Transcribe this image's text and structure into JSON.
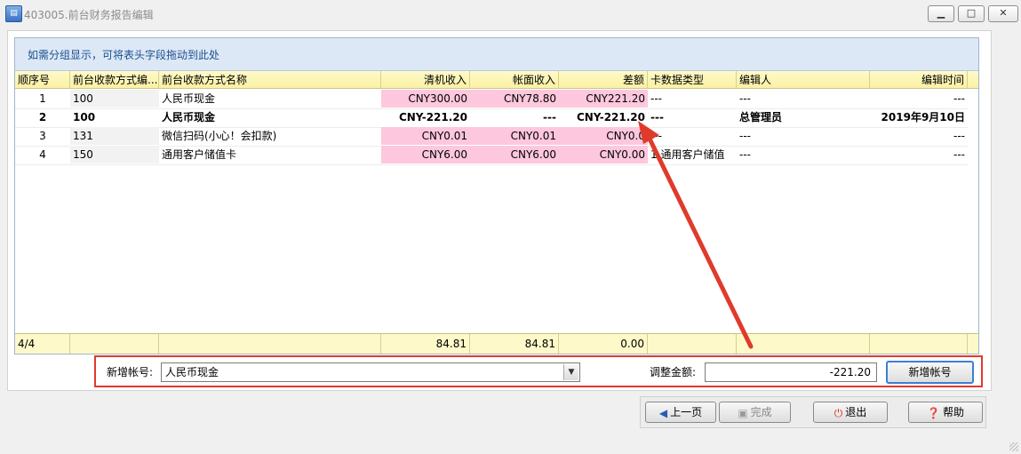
{
  "window": {
    "title": "403005.前台财务报告编辑",
    "icon_name": "app-icon",
    "minimize_icon": "minimize-icon",
    "maximize_icon": "maximize-icon",
    "close_icon": "close-icon"
  },
  "grid": {
    "group_hint": "如需分组显示，可将表头字段拖动到此处",
    "columns": [
      "顺序号",
      "前台收款方式编...",
      "前台收款方式名称",
      "清机收入",
      "帐面收入",
      "差额",
      "卡数据类型",
      "编辑人",
      "编辑时间"
    ],
    "rows": [
      {
        "seq": "1",
        "code": "100",
        "name": "人民币现金",
        "clear": "CNY300.00",
        "book": "CNY78.80",
        "diff": "CNY221.20",
        "card_type": "---",
        "editor": "---",
        "time": "---",
        "bold": false
      },
      {
        "seq": "2",
        "code": "100",
        "name": "人民币现金",
        "clear": "CNY-221.20",
        "book": "---",
        "diff": "CNY-221.20",
        "card_type": "---",
        "editor": "总管理员",
        "time": "2019年9月10日",
        "bold": true
      },
      {
        "seq": "3",
        "code": "131",
        "name": "微信扫码(小心！会扣款)",
        "clear": "CNY0.01",
        "book": "CNY0.01",
        "diff": "CNY0.0",
        "card_type": "---",
        "editor": "---",
        "time": "---",
        "bold": false
      },
      {
        "seq": "4",
        "code": "150",
        "name": "通用客户储值卡",
        "clear": "CNY6.00",
        "book": "CNY6.00",
        "diff": "CNY0.00",
        "card_type": "1 通用客户储值",
        "editor": "---",
        "time": "---",
        "bold": false
      }
    ],
    "footer": {
      "count": "4/4",
      "clear_total": "84.81",
      "book_total": "84.81",
      "diff_total": "0.00"
    }
  },
  "form": {
    "account_label": "新增帐号:",
    "account_value": "人民币现金",
    "amount_label": "调整金额:",
    "amount_value": "-221.20",
    "add_button": "新增帐号"
  },
  "nav": {
    "prev": "上一页",
    "finish": "完成",
    "exit": "退出",
    "help": "帮助"
  },
  "colors": {
    "highlight_pink": "#fdc7dd",
    "header_yellow": "#fbf1a5",
    "annotation_red": "#e03a2c",
    "group_blue": "#dde8f6"
  }
}
